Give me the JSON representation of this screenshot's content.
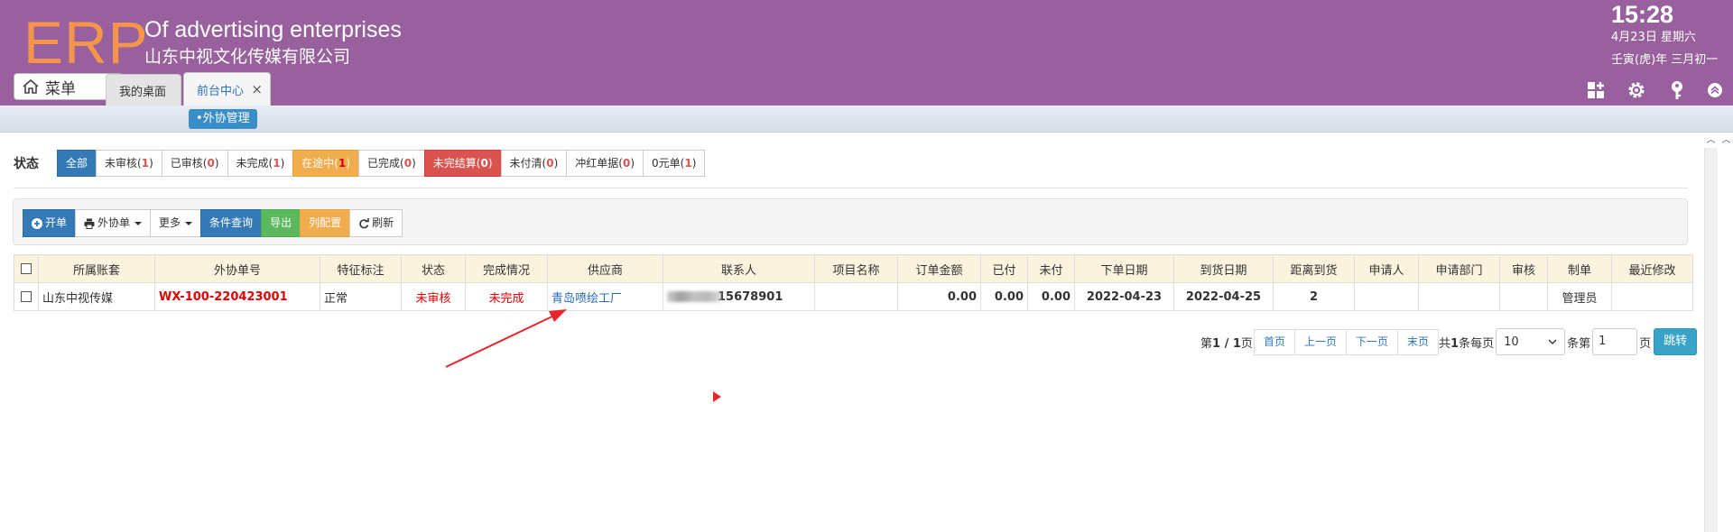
{
  "header": {
    "logo": "ERP",
    "company_en": "Of advertising enterprises",
    "company_cn": "山东中视文化传媒有限公司",
    "menu_label": "菜单",
    "tabs": [
      {
        "label": "我的桌面"
      },
      {
        "label": "前台中心",
        "close": "×"
      }
    ],
    "time": "15:28",
    "date": "4月23日 星期六",
    "lunar": "壬寅(虎)年 三月初一",
    "icons": [
      "grid-plus-icon",
      "gear-icon",
      "key-icon",
      "collapse-up-icon"
    ],
    "bg_color": "#98609c",
    "logo_color": "#f5954d"
  },
  "subnav": {
    "item": "•外协管理"
  },
  "status": {
    "label": "状态",
    "filters": [
      {
        "label": "全部",
        "count": "",
        "style": "active"
      },
      {
        "label": "未审核",
        "count": "1",
        "style": "default"
      },
      {
        "label": "已审核",
        "count": "0",
        "style": "default"
      },
      {
        "label": "未完成",
        "count": "1",
        "style": "default"
      },
      {
        "label": "在途中",
        "count": "1",
        "style": "orange"
      },
      {
        "label": "已完成",
        "count": "0",
        "style": "default"
      },
      {
        "label": "未完结算",
        "count": "0",
        "style": "red"
      },
      {
        "label": "未付清",
        "count": "0",
        "style": "default"
      },
      {
        "label": "冲红单据",
        "count": "0",
        "style": "default"
      },
      {
        "label": "0元单",
        "count": "1",
        "style": "default"
      }
    ]
  },
  "toolbar": {
    "open_label": "开单",
    "print_label": "外协单",
    "more_label": "更多",
    "query_label": "条件查询",
    "export_label": "导出",
    "columns_label": "列配置",
    "refresh_label": "刷新"
  },
  "table": {
    "headers": [
      "所属账套",
      "外协单号",
      "特征标注",
      "状态",
      "完成情况",
      "供应商",
      "联系人",
      "项目名称",
      "订单金额",
      "已付",
      "未付",
      "下单日期",
      "到货日期",
      "距离到货",
      "申请人",
      "申请部门",
      "审核",
      "制单",
      "最近修改"
    ],
    "rows": [
      {
        "account": "山东中视传媒",
        "order_no": "WX-100-220423001",
        "tag": "正常",
        "status": "未审核",
        "completion": "未完成",
        "supplier": "青岛喷绘工厂",
        "contact": "15678901",
        "project": "",
        "amount": "0.00",
        "paid": "0.00",
        "unpaid": "0.00",
        "order_date": "2022-04-23",
        "arrival_date": "2022-04-25",
        "days_left": "2",
        "applicant": "",
        "department": "",
        "audit": "",
        "creator": "管理员",
        "modified": ""
      }
    ]
  },
  "pager": {
    "info_prefix": "第",
    "current": "1",
    "total": "1",
    "info_suffix": "页",
    "first": "首页",
    "prev": "上一页",
    "next": "下一页",
    "last": "末页",
    "total_prefix": "共",
    "total_count": "1",
    "per_page_label": "条每页",
    "page_size": "10",
    "goto_prefix": "条第",
    "goto_value": "1",
    "goto_suffix": "页",
    "go_label": "跳转"
  },
  "colors": {
    "primary": "#337ab7",
    "warning": "#f0ad4e",
    "danger": "#d9534f",
    "success": "#5cb85c",
    "table_header": "#fcf3df",
    "annotation": "#e8262a"
  }
}
